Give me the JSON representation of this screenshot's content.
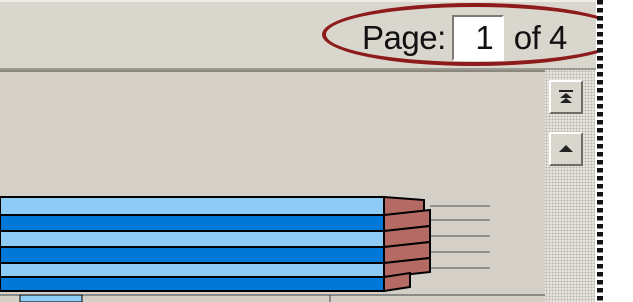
{
  "pager": {
    "label": "Page:",
    "current_page": "1",
    "total": "of 4"
  },
  "scrollbar": {
    "first_page_icon": "double-up-arrow-icon",
    "prev_page_icon": "up-arrow-icon"
  },
  "colors": {
    "callout": "#8e1b1b",
    "bar_light": "#8ecbf5",
    "bar_dark": "#0078d7",
    "bar_end": "#b56a63"
  }
}
